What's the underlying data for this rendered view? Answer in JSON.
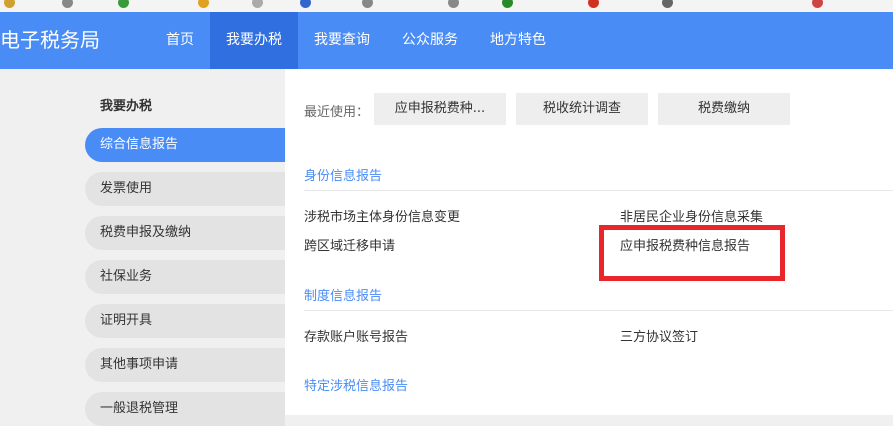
{
  "header": {
    "site_title": "电子税务局",
    "nav": [
      {
        "label": "首页",
        "active": false
      },
      {
        "label": "我要办税",
        "active": true
      },
      {
        "label": "我要查询",
        "active": false
      },
      {
        "label": "公众服务",
        "active": false
      },
      {
        "label": "地方特色",
        "active": false
      }
    ]
  },
  "sidebar": {
    "title": "我要办税",
    "items": [
      {
        "label": "综合信息报告",
        "active": true
      },
      {
        "label": "发票使用",
        "active": false
      },
      {
        "label": "税费申报及缴纳",
        "active": false
      },
      {
        "label": "社保业务",
        "active": false
      },
      {
        "label": "证明开具",
        "active": false
      },
      {
        "label": "其他事项申请",
        "active": false
      },
      {
        "label": "一般退税管理",
        "active": false
      }
    ]
  },
  "main": {
    "recent_label": "最近使用：",
    "recent": [
      "应申报税费种...",
      "税收统计调查",
      "税费缴纳"
    ],
    "sections": [
      {
        "title": "身份信息报告",
        "items": [
          "涉税市场主体身份信息变更",
          "非居民企业身份信息采集",
          "跨区域迁移申请",
          "应申报税费种信息报告"
        ]
      },
      {
        "title": "制度信息报告",
        "items": [
          "存款账户账号报告",
          "三方协议签订"
        ]
      },
      {
        "title": "特定涉税信息报告",
        "items": []
      }
    ]
  },
  "colors": {
    "header_blue": "#4a8cf6",
    "nav_active": "#2f6fe0",
    "section_blue": "#4a8cf6",
    "highlight_red": "#e8262c"
  }
}
